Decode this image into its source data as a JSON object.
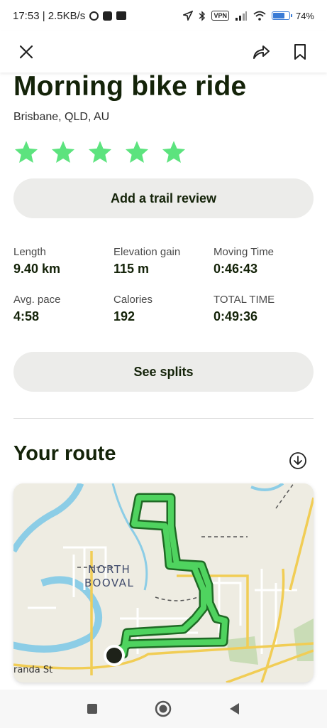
{
  "status_bar": {
    "time_speed": "17:53 | 2.5KB/s",
    "vpn": "VPN",
    "battery": "74%",
    "battery_level": 0.74
  },
  "header": {
    "close_icon": "close-icon",
    "share_icon": "share-icon",
    "bookmark_icon": "bookmark-icon"
  },
  "activity": {
    "title": "Morning bike ride",
    "location": "Brisbane, QLD, AU",
    "rating": 5,
    "rating_max": 5,
    "star_color": "#5ce37e"
  },
  "review_button": {
    "label": "Add a trail review"
  },
  "stats": [
    {
      "label": "Length",
      "value": "9.40 km"
    },
    {
      "label": "Elevation gain",
      "value": "115 m"
    },
    {
      "label": "Moving Time",
      "value": "0:46:43"
    },
    {
      "label": "Avg. pace",
      "value": "4:58"
    },
    {
      "label": "Calories",
      "value": "192"
    },
    {
      "label": "TOTAL TIME",
      "value": "0:49:36"
    }
  ],
  "splits_button": {
    "label": "See splits"
  },
  "route": {
    "title": "Your route",
    "download_icon": "download-icon",
    "map_labels": {
      "suburb_line1": "NORTH",
      "suburb_line2": "BOOVAL",
      "street": "randa St"
    },
    "route_color": "#4fd35f",
    "route_outline": "#1f6a25",
    "water_color": "#8ccde6",
    "road_color": "#f1cd55"
  },
  "nav_bar": {
    "recents_icon": "square-icon",
    "home_icon": "circle-icon",
    "back_icon": "triangle-back-icon"
  }
}
